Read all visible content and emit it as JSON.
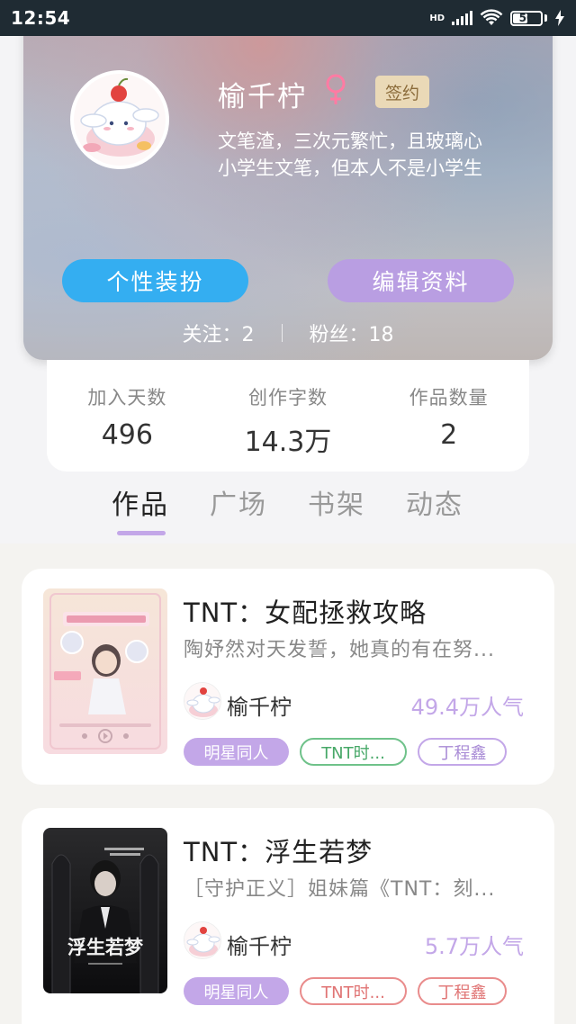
{
  "status_bar": {
    "time": "12:54",
    "network": "HD",
    "battery": "50"
  },
  "profile": {
    "username": "榆千柠",
    "gender": "♀",
    "badge": "签约",
    "bio_line1": "文笔渣，三次元繁忙，且玻璃心",
    "bio_line2": "小学生文笔，但本人不是小学生",
    "dressup_button": "个性装扮",
    "edit_button": "编辑资料",
    "following": "关注：2",
    "followers": "粉丝：18"
  },
  "stats": [
    {
      "label": "加入天数",
      "value": "496"
    },
    {
      "label": "创作字数",
      "value": "14.3万"
    },
    {
      "label": "作品数量",
      "value": "2"
    }
  ],
  "tabs": [
    {
      "label": "作品",
      "active": true
    },
    {
      "label": "广场",
      "active": false
    },
    {
      "label": "书架",
      "active": false
    },
    {
      "label": "动态",
      "active": false
    }
  ],
  "works": [
    {
      "title": "TNT：女配拯救攻略",
      "desc": "陶妤然对天发誓，她真的有在努...",
      "author": "榆千柠",
      "popularity": "49.4万人气",
      "tags": [
        "明星同人",
        "TNT时...",
        "丁程鑫"
      ]
    },
    {
      "title": "TNT：浮生若梦",
      "desc": "［守护正义］姐妹篇《TNT：刻...",
      "author": "榆千柠",
      "popularity": "5.7万人气",
      "tags": [
        "明星同人",
        "TNT时...",
        "丁程鑫"
      ]
    }
  ],
  "colors": {
    "accent_purple": "#c3a7e8",
    "accent_blue": "#34aef1",
    "badge_gold": "#ead9b7"
  }
}
